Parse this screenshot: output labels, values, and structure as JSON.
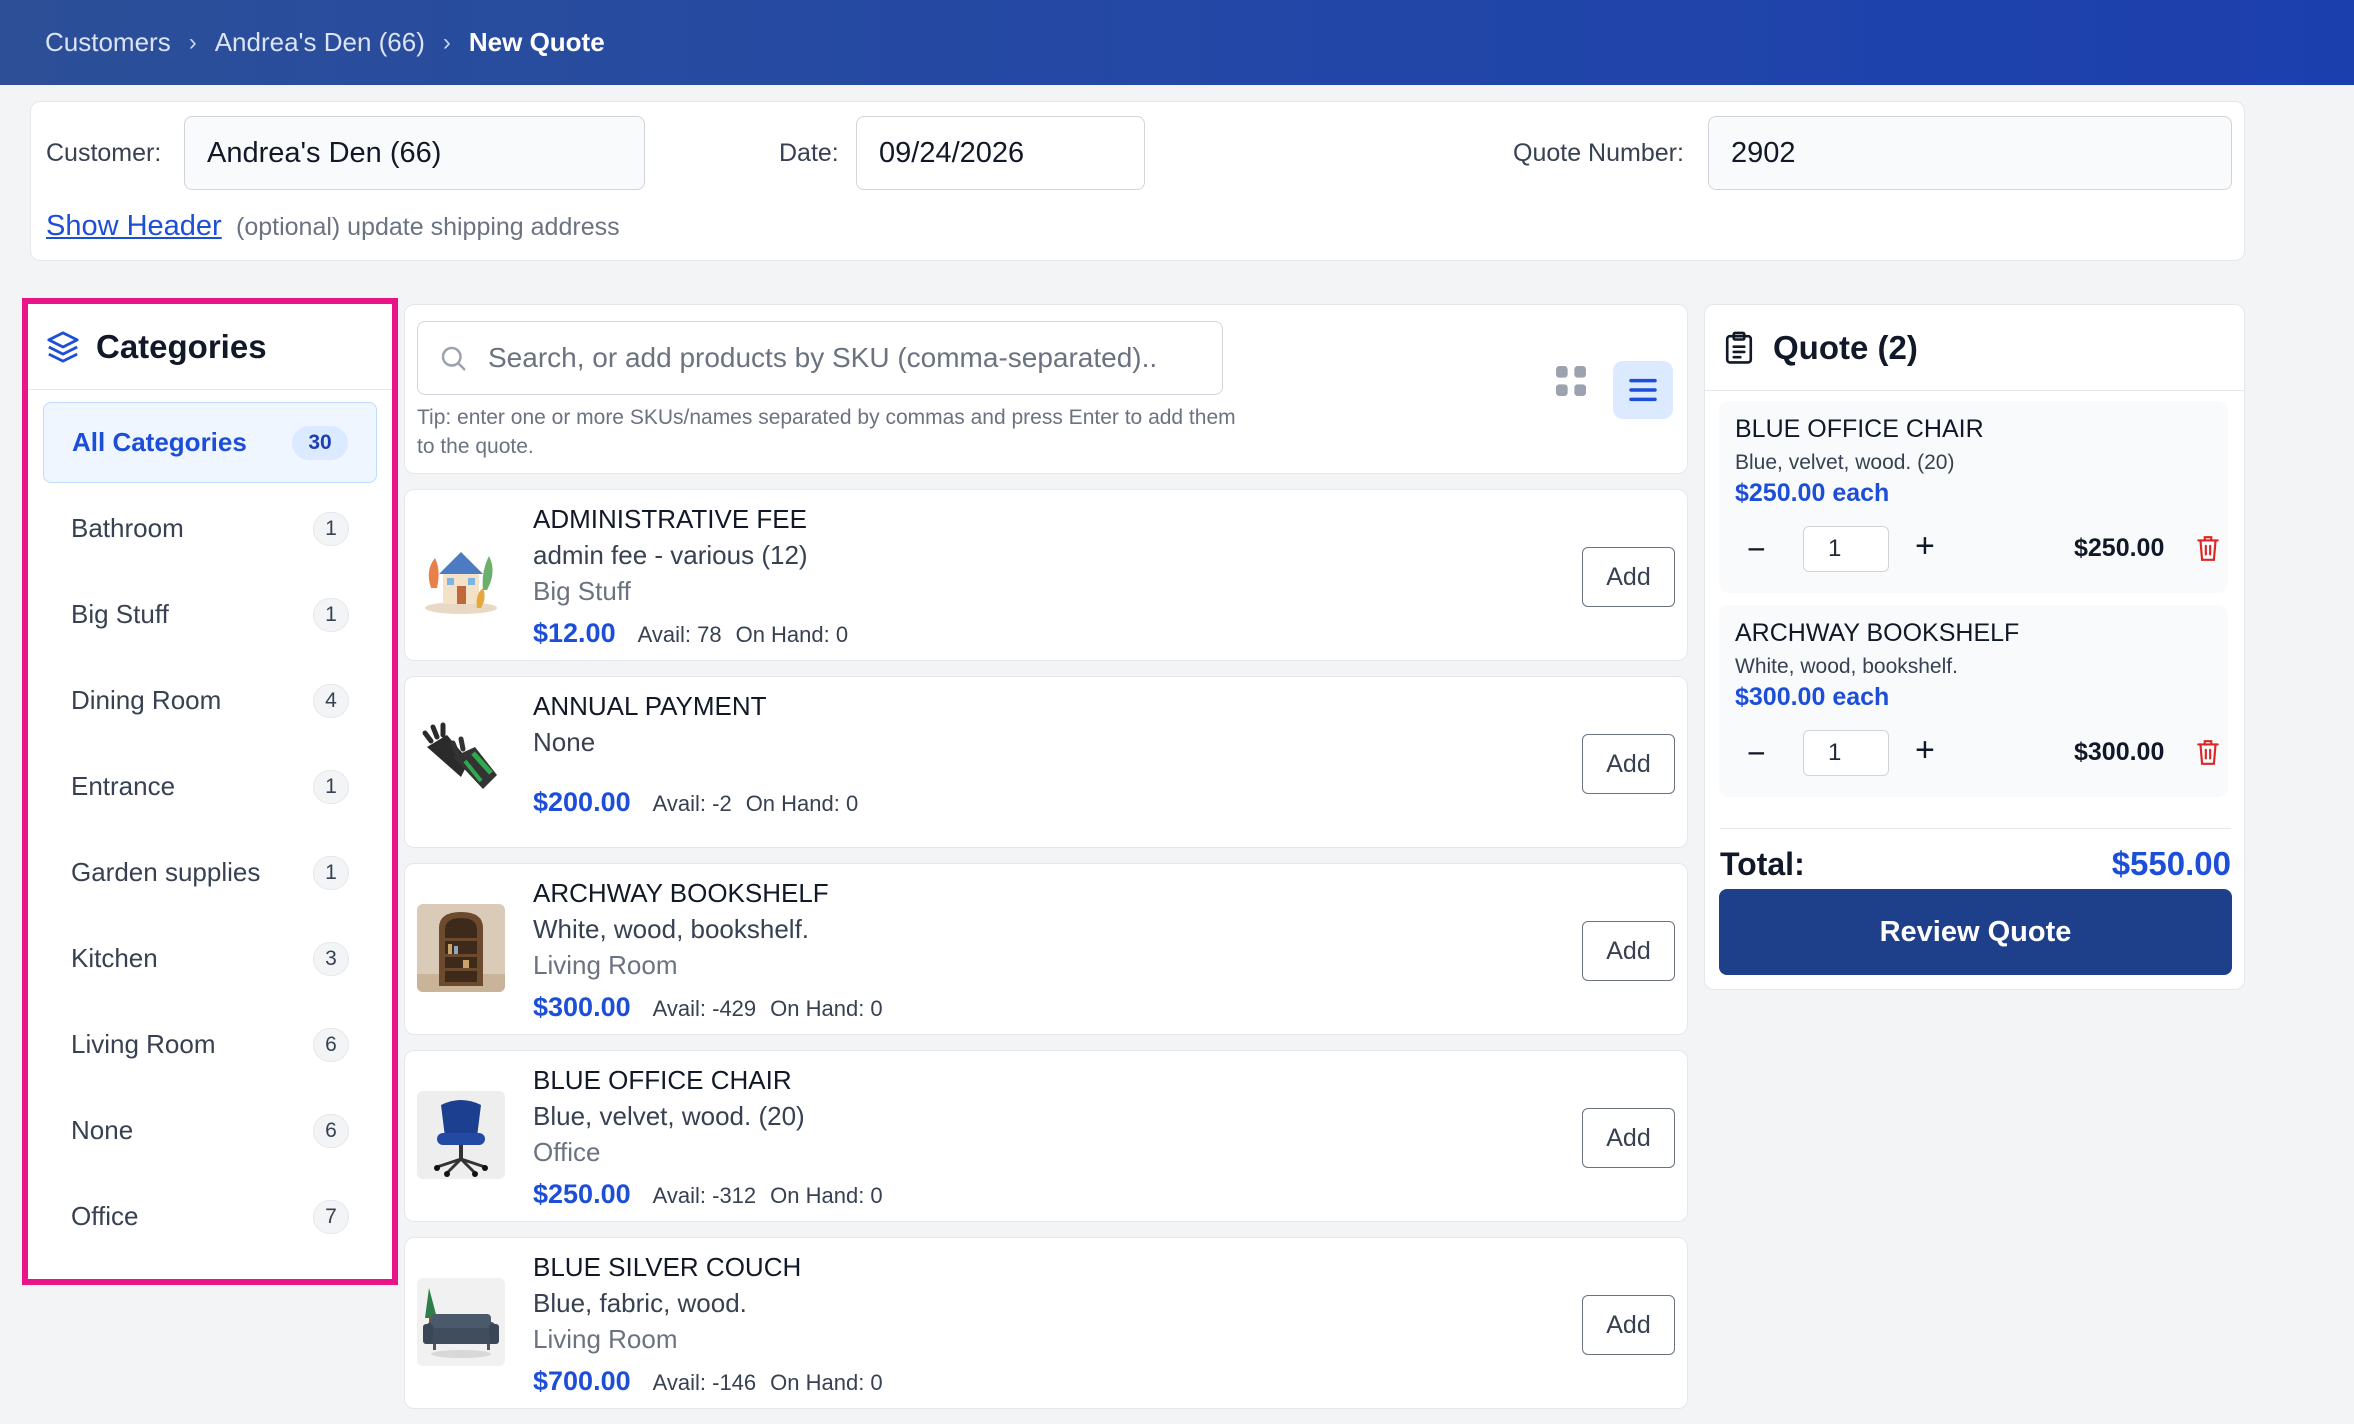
{
  "breadcrumb": {
    "items": [
      "Customers",
      "Andrea's Den (66)",
      "New Quote"
    ],
    "separator": "›"
  },
  "header": {
    "customer_label": "Customer:",
    "customer_value": "Andrea's Den (66)",
    "date_label": "Date:",
    "date_value": "09/24/2026",
    "quote_number_label": "Quote Number:",
    "quote_number_value": "2902",
    "show_header_link": "Show Header",
    "show_header_hint": "(optional) update shipping address"
  },
  "sidebar": {
    "title": "Categories",
    "items": [
      {
        "label": "All Categories",
        "count": "30",
        "active": true
      },
      {
        "label": "Bathroom",
        "count": "1"
      },
      {
        "label": "Big Stuff",
        "count": "1"
      },
      {
        "label": "Dining Room",
        "count": "4"
      },
      {
        "label": "Entrance",
        "count": "1"
      },
      {
        "label": "Garden supplies",
        "count": "1"
      },
      {
        "label": "Kitchen",
        "count": "3"
      },
      {
        "label": "Living Room",
        "count": "6"
      },
      {
        "label": "None",
        "count": "6"
      },
      {
        "label": "Office",
        "count": "7"
      }
    ]
  },
  "search": {
    "placeholder": "Search, or add products by SKU (comma-separated)..",
    "tip": "Tip: enter one or more SKUs/names separated by commas and press Enter to add them to the quote."
  },
  "products": [
    {
      "name": "ADMINISTRATIVE FEE",
      "desc": "admin fee - various (12)",
      "category": "Big Stuff",
      "price": "$12.00",
      "avail": "Avail: 78",
      "onhand": "On Hand: 0",
      "add_label": "Add"
    },
    {
      "name": "ANNUAL PAYMENT",
      "desc": "None",
      "category": "",
      "price": "$200.00",
      "avail": "Avail: -2",
      "onhand": "On Hand: 0",
      "add_label": "Add"
    },
    {
      "name": "ARCHWAY BOOKSHELF",
      "desc": "White, wood, bookshelf.",
      "category": "Living Room",
      "price": "$300.00",
      "avail": "Avail: -429",
      "onhand": "On Hand: 0",
      "add_label": "Add"
    },
    {
      "name": "BLUE OFFICE CHAIR",
      "desc": "Blue, velvet, wood. (20)",
      "category": "Office",
      "price": "$250.00",
      "avail": "Avail: -312",
      "onhand": "On Hand: 0",
      "add_label": "Add"
    },
    {
      "name": "BLUE SILVER COUCH",
      "desc": "Blue, fabric, wood.",
      "category": "Living Room",
      "price": "$700.00",
      "avail": "Avail: -146",
      "onhand": "On Hand: 0",
      "add_label": "Add"
    }
  ],
  "quote": {
    "title": "Quote (2)",
    "items": [
      {
        "name": "BLUE OFFICE CHAIR",
        "desc": "Blue, velvet, wood. (20)",
        "each": "$250.00 each",
        "qty": "1",
        "minus": "−",
        "plus": "+",
        "line_total": "$250.00"
      },
      {
        "name": "ARCHWAY BOOKSHELF",
        "desc": "White, wood, bookshelf.",
        "each": "$300.00 each",
        "qty": "1",
        "minus": "−",
        "plus": "+",
        "line_total": "$300.00"
      }
    ],
    "total_label": "Total:",
    "total_value": "$550.00",
    "review_label": "Review Quote"
  },
  "colors": {
    "accent": "#1d4ed8",
    "topbar": "#2146a8",
    "highlight_border": "#e8158a",
    "delete": "#dc2626",
    "review_button": "#1e3f8a"
  }
}
